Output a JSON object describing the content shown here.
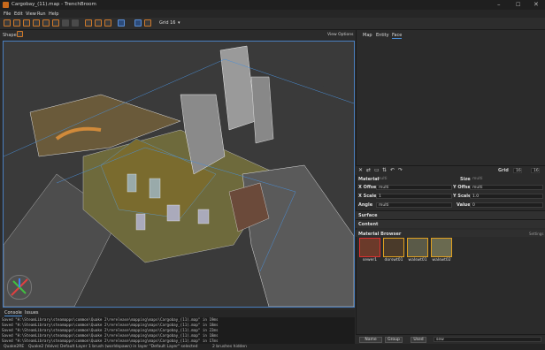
{
  "window": {
    "title": "Cargobay_(11).map - TrenchBroom"
  },
  "menubar": {
    "items": [
      "File",
      "Edit",
      "View",
      "Run",
      "Help"
    ]
  },
  "toolbar": {
    "grid_label": "Grid 16"
  },
  "viewport": {
    "shape_label": "Shape",
    "view_options": "View Options"
  },
  "console": {
    "tabs": [
      "Console",
      "Issues"
    ],
    "lines": [
      "Saved \"H:\\SteamLibrary\\steamapps\\common\\Quake 2\\rerelease\\mapping\\maps\\Cargobay_(11).map\" in 19ms",
      "Saved \"H:\\SteamLibrary\\steamapps\\common\\Quake 2\\rerelease\\mapping\\maps\\Cargobay_(11).map\" in 18ms",
      "Saved \"H:\\SteamLibrary\\steamapps\\common\\Quake 2\\rerelease\\mapping\\maps\\Cargobay_(11).map\" in 22ms",
      "Saved \"H:\\SteamLibrary\\steamapps\\common\\Quake 2\\rerelease\\mapping\\maps\\Cargobay_(11).map\" in 18ms",
      "Saved \"H:\\SteamLibrary\\steamapps\\common\\Quake 2\\rerelease\\mapping\\maps\\Cargobay_(11).map\" in 17ms"
    ]
  },
  "status": {
    "items": [
      "Quake2RE",
      "Quake2 (Valve)",
      "Default Layer",
      "1 brush (worldspawn) in layer \"Default Layer\" selected",
      "2 brushes hidden"
    ]
  },
  "inspector": {
    "tabs": [
      "Map",
      "Entity",
      "Face"
    ],
    "grid_label": "Grid",
    "grid_value": "16",
    "material_label": "Material",
    "material_value": "multi",
    "size_label": "Size",
    "size_value": "multi",
    "x_offset_label": "X Offset",
    "x_offset_value": "multi",
    "y_offset_label": "Y Offset",
    "y_offset_value": "multi",
    "x_scale_label": "X Scale",
    "x_scale_value": "1",
    "y_scale_label": "Y Scale",
    "y_scale_value": "1.0",
    "angle_label": "Angle",
    "angle_value": "multi",
    "value_label": "Value",
    "value_value": "0",
    "surface_label": "Surface",
    "content_label": "Content",
    "material_browser_label": "Material Browser",
    "settings_label": "Settings"
  },
  "materials": [
    {
      "name": "sewer1",
      "color": "#6b3a2a"
    },
    {
      "name": "dorswt01",
      "color": "#4a3a2a"
    },
    {
      "name": "walswt01",
      "color": "#5a5a48"
    },
    {
      "name": "walswt02",
      "color": "#6a6a50"
    }
  ],
  "browser_footer": {
    "sort_name": "Name",
    "group": "Group",
    "used": "Used",
    "search": "sew"
  }
}
